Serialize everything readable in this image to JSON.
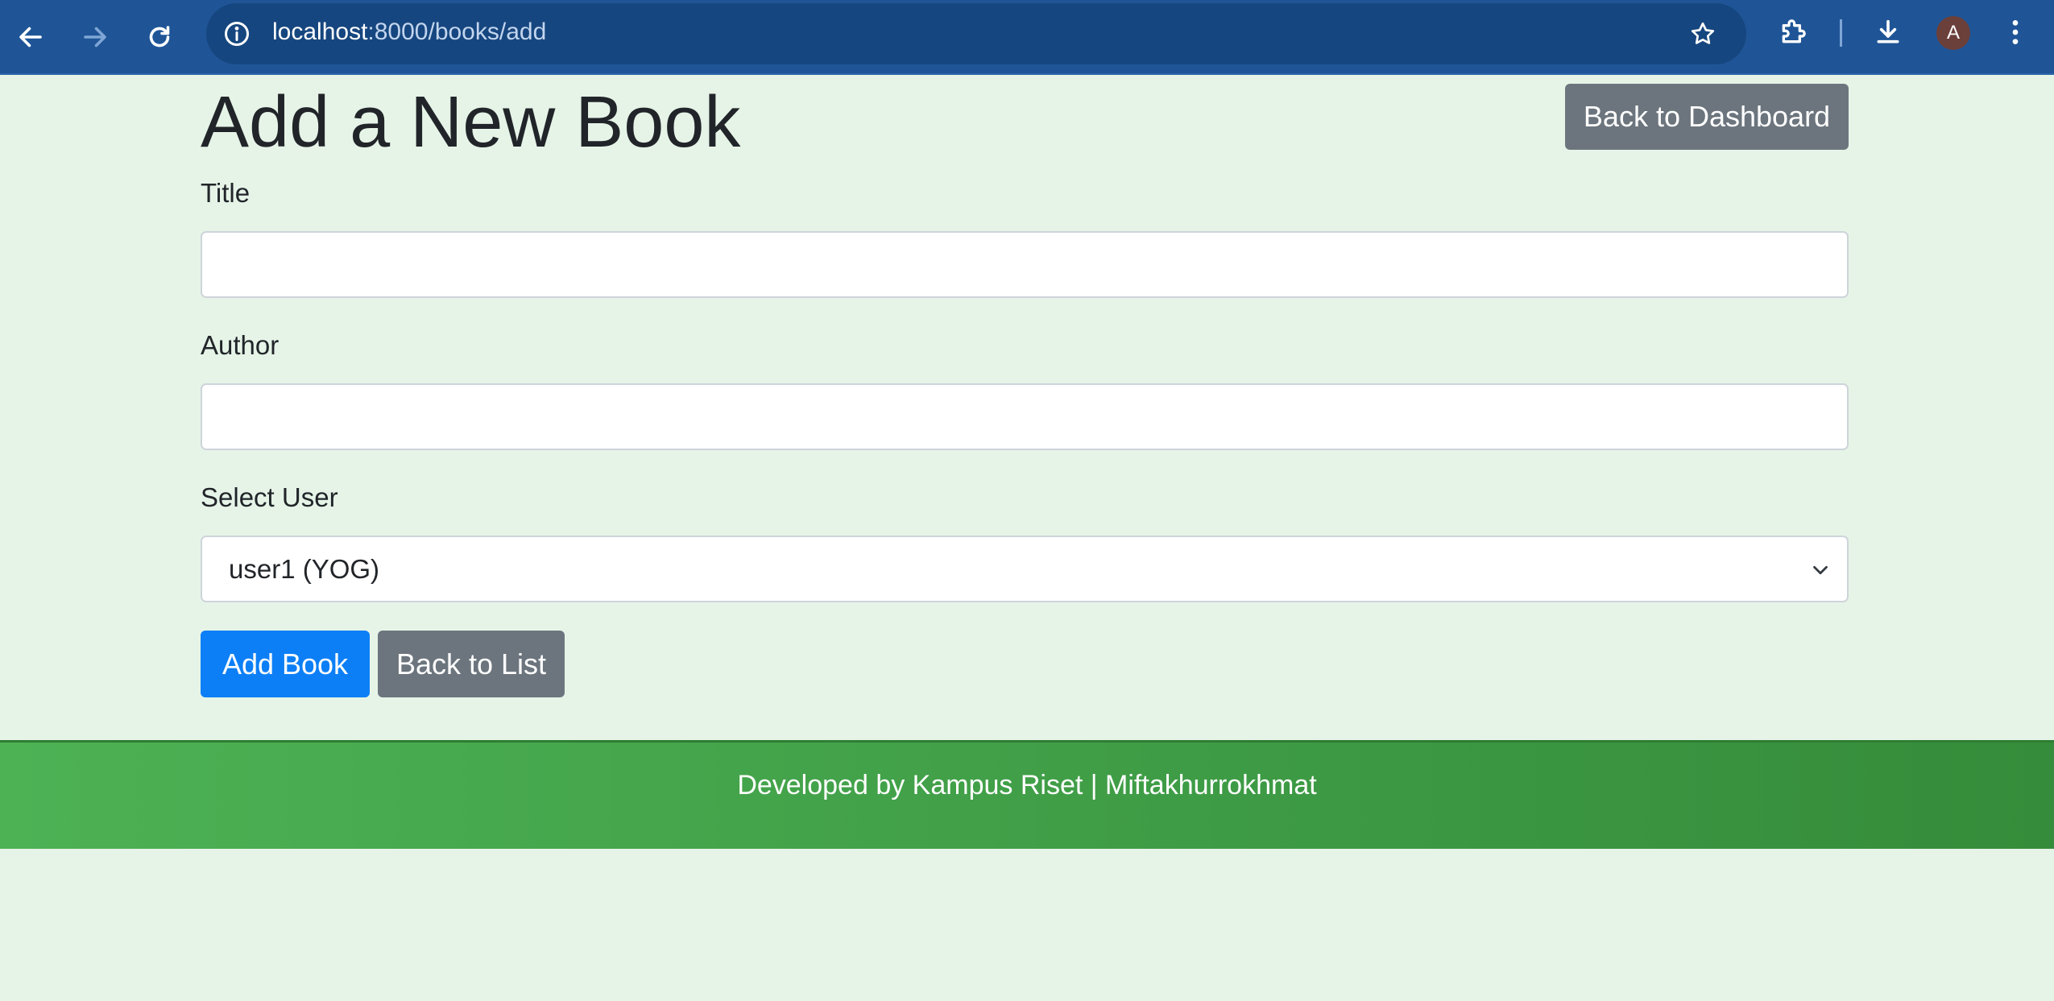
{
  "browser": {
    "url_host": "localhost",
    "url_path": ":8000/books/add",
    "back_icon": "arrow-left-icon",
    "forward_icon": "arrow-right-icon",
    "reload_icon": "reload-icon",
    "info_icon": "info-icon",
    "bookmark_icon": "star-icon",
    "extensions_icon": "puzzle-icon",
    "downloads_icon": "download-icon",
    "profile_initial": "A",
    "menu_icon": "kebab-menu-icon"
  },
  "page": {
    "title": "Add a New Book",
    "back_to_dashboard_label": "Back to Dashboard"
  },
  "form": {
    "title_label": "Title",
    "title_value": "",
    "author_label": "Author",
    "author_value": "",
    "user_label": "Select User",
    "user_selected": "user1 (YOG)",
    "add_button_label": "Add Book",
    "back_to_list_label": "Back to List"
  },
  "footer": {
    "text": "Developed by Kampus Riset | Miftakhurrokhmat"
  },
  "colors": {
    "browser_bar": "#1f5597",
    "page_bg": "#e6f4e8",
    "primary": "#0d7ff6",
    "secondary": "#6c757d",
    "footer": "#43a047"
  }
}
